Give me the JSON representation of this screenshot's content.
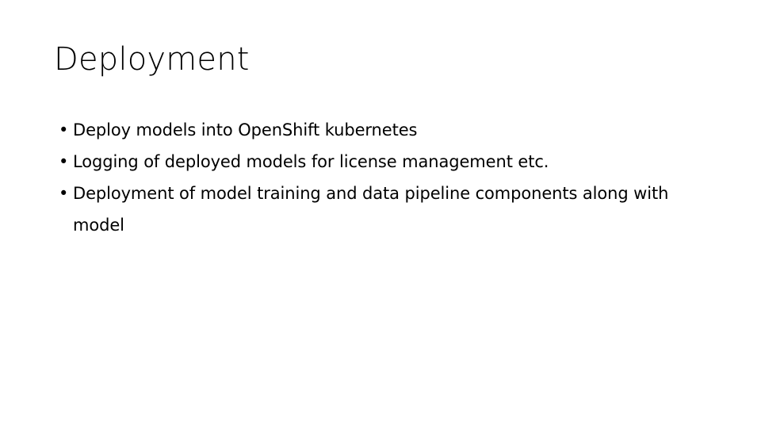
{
  "slide": {
    "title": "Deployment",
    "bullet_marker": "•",
    "bullets": [
      {
        "text": "Deploy models into OpenShift kubernetes"
      },
      {
        "text": "Logging of deployed models for license management etc."
      },
      {
        "text": "Deployment of model training and data pipeline components along with model"
      }
    ],
    "colors": {
      "background": "#ffffff",
      "text": "#000000"
    }
  }
}
